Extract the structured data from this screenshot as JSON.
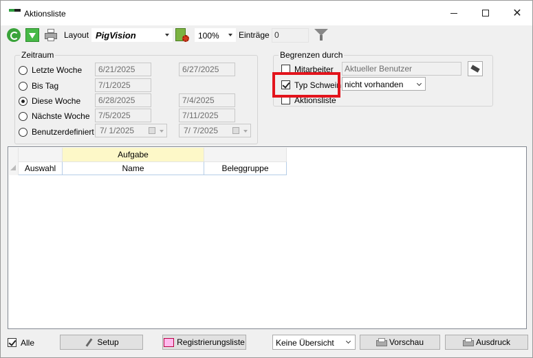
{
  "window": {
    "title": "Aktionsliste"
  },
  "toolbar": {
    "layout_label": "Layout",
    "layout_value": "PigVision",
    "zoom_value": "100%",
    "entries_label": "Einträge",
    "entries_value": "0"
  },
  "zeitraum": {
    "legend": "Zeitraum",
    "options": [
      {
        "label": "Letzte Woche",
        "from": "6/21/2025",
        "to": "6/27/2025",
        "selected": false
      },
      {
        "label": "Bis Tag",
        "from": "7/1/2025",
        "to": "",
        "selected": false
      },
      {
        "label": "Diese Woche",
        "from": "6/28/2025",
        "to": "7/4/2025",
        "selected": true
      },
      {
        "label": "Nächste Woche",
        "from": "7/5/2025",
        "to": "7/11/2025",
        "selected": false
      },
      {
        "label": "Benutzerdefiniert",
        "from": "7/  1/2025",
        "to": "7/  7/2025",
        "selected": false
      }
    ]
  },
  "begrenzen": {
    "legend": "Begrenzen durch",
    "mitarbeiter_label": "Mitarbeiter",
    "mitarbeiter_checked": false,
    "user_field": "Aktueller Benutzer",
    "typ_label": "Typ Schwein",
    "typ_checked": true,
    "typ_value": "nicht vorhanden",
    "aktionsliste_label": "Aktionsliste",
    "aktionsliste_checked": false,
    "highlight_color": "#e3141c"
  },
  "grid": {
    "band_label": "Aufgabe",
    "columns": [
      "Auswahl",
      "Name",
      "Beleggruppe"
    ],
    "band_color": "#fdf8c8"
  },
  "footer": {
    "alle_label": "Alle",
    "alle_checked": true,
    "setup_label": "Setup",
    "registrierung_label": "Registrierungsliste",
    "view_value": "Keine Übersicht",
    "vorschau_label": "Vorschau",
    "ausdruck_label": "Ausdruck"
  }
}
